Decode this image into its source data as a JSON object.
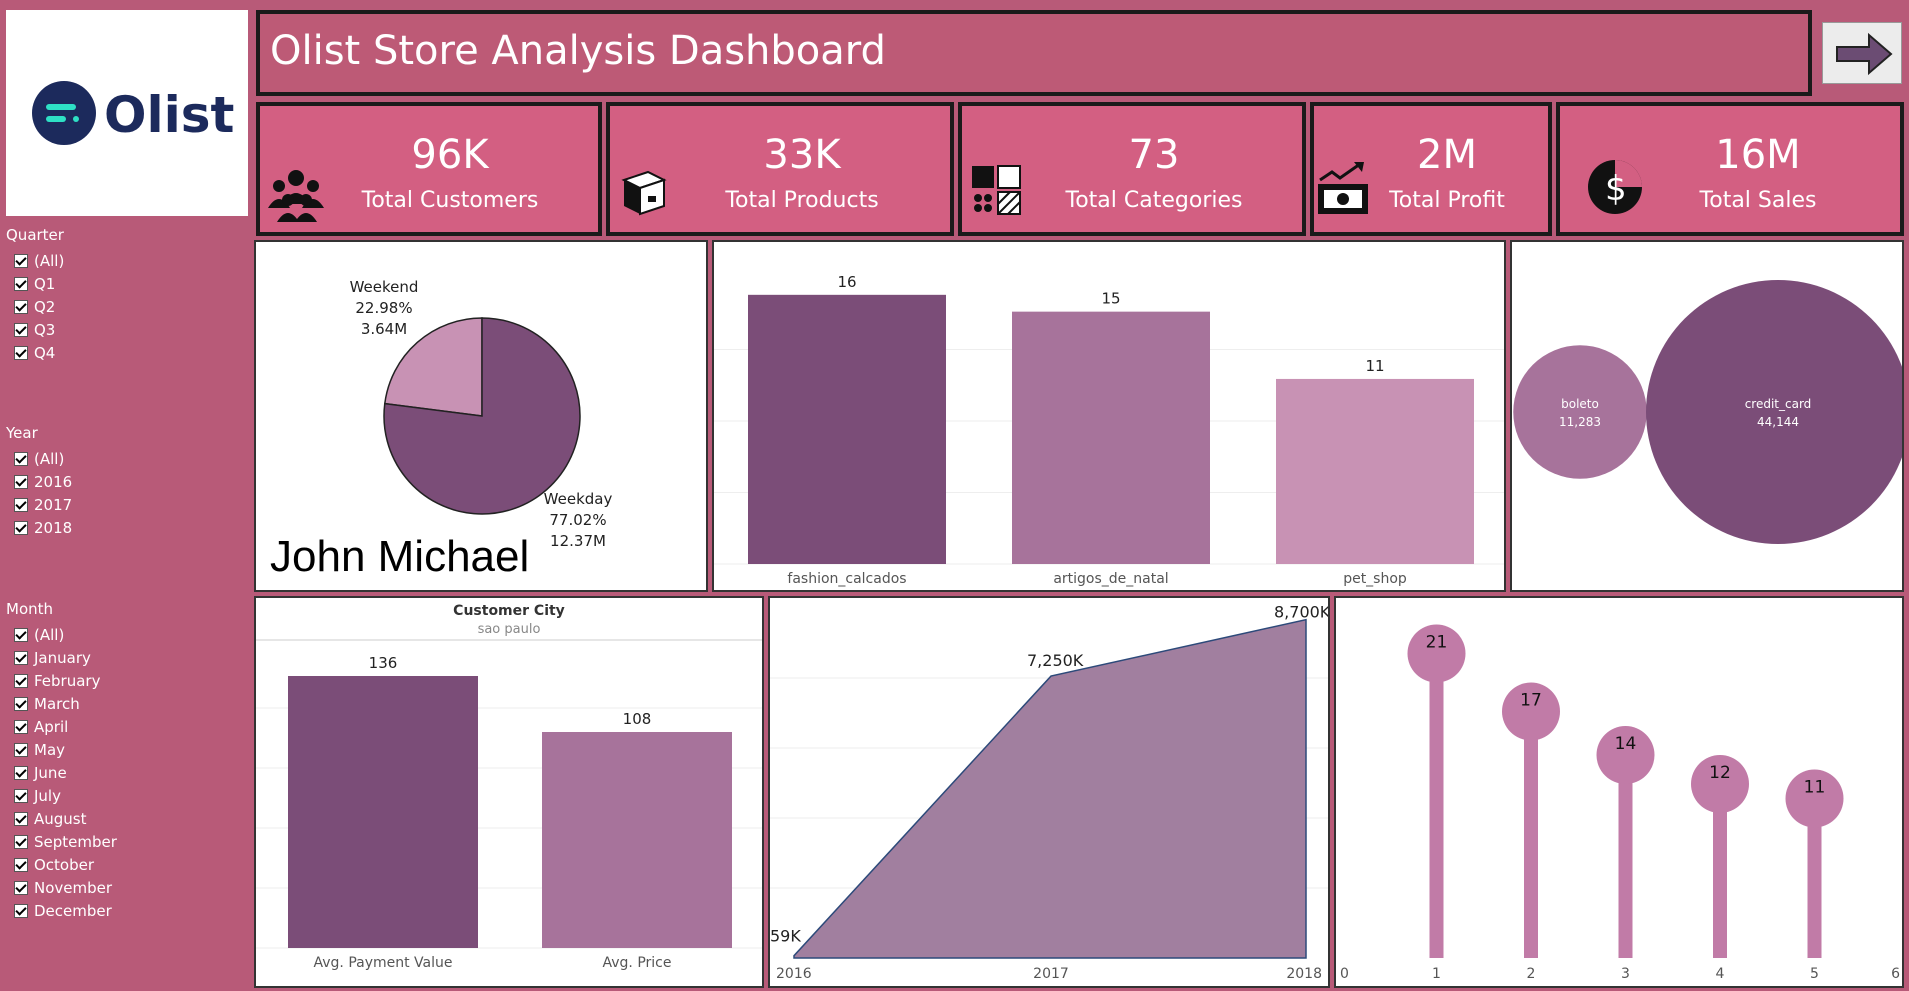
{
  "header": {
    "title": "Olist Store Analysis Dashboard"
  },
  "logo": {
    "text": "Olist",
    "icon": "olist-logo-icon"
  },
  "kpis": [
    {
      "value": "96K",
      "label": "Total Customers",
      "icon": "customers-icon"
    },
    {
      "value": "33K",
      "label": "Total Products",
      "icon": "product-box-icon"
    },
    {
      "value": "73",
      "label": "Total Categories",
      "icon": "categories-icon"
    },
    {
      "value": "2M",
      "label": "Total Profit",
      "icon": "profit-icon"
    },
    {
      "value": "16M",
      "label": "Total Sales",
      "icon": "sales-icon"
    }
  ],
  "filters": {
    "quarter": {
      "title": "Quarter",
      "items": [
        "(All)",
        "Q1",
        "Q2",
        "Q3",
        "Q4"
      ]
    },
    "year": {
      "title": "Year",
      "items": [
        "(All)",
        "2016",
        "2017",
        "2018"
      ]
    },
    "month": {
      "title": "Month",
      "items": [
        "(All)",
        "January",
        "February",
        "March",
        "April",
        "May",
        "June",
        "July",
        "August",
        "September",
        "October",
        "November",
        "December"
      ]
    }
  },
  "signature": "John Michael",
  "colors": {
    "background": "#b85a78",
    "kpi": "#d35f82",
    "dark_purple": "#7b4d78",
    "mid_purple": "#a7739b",
    "light_purple": "#c892b4",
    "lollipop": "#c17ba7"
  },
  "chart_data": [
    {
      "type": "pie",
      "slices": [
        {
          "name": "Weekend",
          "percent": "22.98%",
          "amount": "3.64M",
          "value": 22.98
        },
        {
          "name": "Weekday",
          "percent": "77.02%",
          "amount": "12.37M",
          "value": 77.02
        }
      ]
    },
    {
      "type": "bar",
      "categories": [
        "fashion_calcados",
        "artigos_de_natal",
        "pet_shop"
      ],
      "values": [
        16,
        15,
        11
      ],
      "ylim": [
        0,
        17
      ]
    },
    {
      "type": "bubble",
      "items": [
        {
          "name": "boleto",
          "label": "11,283",
          "value": 11283
        },
        {
          "name": "credit_card",
          "label": "44,144",
          "value": 44144
        }
      ]
    },
    {
      "type": "bar",
      "title": "Customer City",
      "subtitle": "sao paulo",
      "categories": [
        "Avg. Payment Value",
        "Avg. Price"
      ],
      "values": [
        136,
        108
      ],
      "ylim": [
        0,
        150
      ]
    },
    {
      "type": "area",
      "x": [
        "2016",
        "2017",
        "2018"
      ],
      "values": [
        59,
        7250,
        8700
      ],
      "labels": [
        "59K",
        "7,250K",
        "8,700K"
      ],
      "ylim": [
        0,
        9000
      ]
    },
    {
      "type": "lollipop",
      "x": [
        1,
        2,
        3,
        4,
        5
      ],
      "values": [
        21,
        17,
        14,
        12,
        11
      ],
      "x_ticks": [
        "0",
        "1",
        "2",
        "3",
        "4",
        "5",
        "6"
      ],
      "ylim": [
        0,
        24
      ]
    }
  ]
}
